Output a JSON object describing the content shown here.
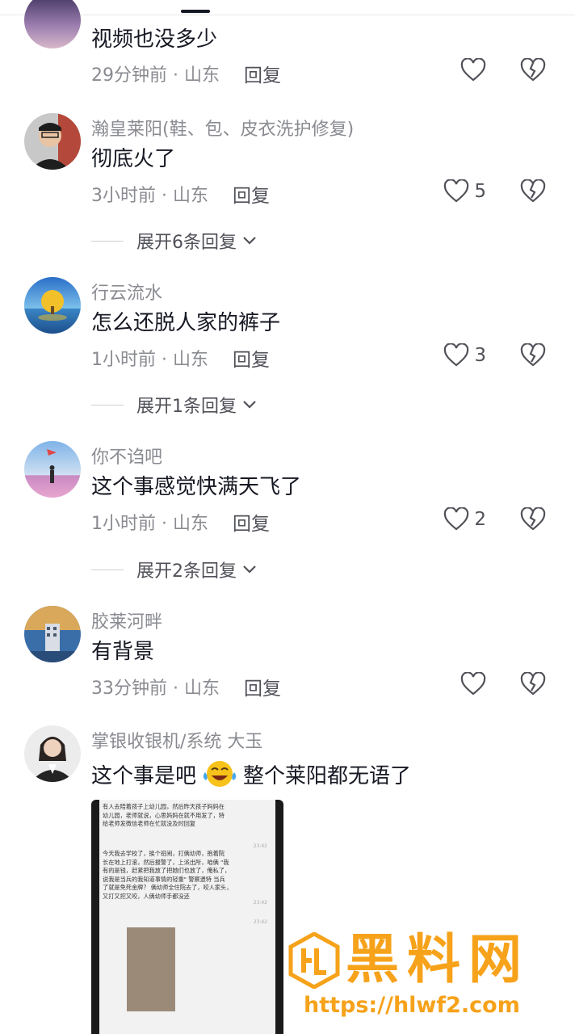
{
  "comments": [
    {
      "username": "",
      "content": "视频也没多少",
      "time_location": "29分钟前 · 山东",
      "reply": "回复",
      "likes": ""
    },
    {
      "username": "瀚皇莱阳(鞋、包、皮衣洗护修复)",
      "content": "彻底火了",
      "time_location": "3小时前 · 山东",
      "reply": "回复",
      "likes": "5",
      "expand": "展开6条回复"
    },
    {
      "username": "行云流水",
      "content": "怎么还脱人家的裤子",
      "time_location": "1小时前 · 山东",
      "reply": "回复",
      "likes": "3",
      "expand": "展开1条回复"
    },
    {
      "username": "你不诌吧",
      "content": "这个事感觉快满天飞了",
      "time_location": "1小时前 · 山东",
      "reply": "回复",
      "likes": "2",
      "expand": "展开2条回复"
    },
    {
      "username": "胶莱河畔",
      "content": "有背景",
      "time_location": "33分钟前 · 山东",
      "reply": "回复",
      "likes": ""
    },
    {
      "username": "掌银收银机/系统 大玉",
      "content_before_emoji": "这个事是吧",
      "content_after_emoji": "整个莱阳都无语了",
      "emoji": "laughing-tears-emoji"
    }
  ],
  "screenshot_image": {
    "text_top": "有人去陪着孩子上幼儿园，然后昨天孩子妈妈在\n幼儿园，老师就说，心思妈妈在就不用发了，特\n给老师发微信老师在忙就没及时回复",
    "time_1": "23:42",
    "text_mid": "今天我去学校了，挨个班闹，打俩幼师，抱着院\n长在地上打滚，然后报警了，上派出所，咱俩 \"我\n有的是钱，赶紧把我放了把她们也放了，俺私了，\n说我是当兵的我知道事情的轻重\" 警察遗特 当兵\n了就是免死金牌？ 俩幼师全住院去了，咬人家头，\n又打又挖又咬，人俩幼师手都没还",
    "time_2": "23:42",
    "time_3": "23:42"
  },
  "watermark": {
    "title": "黑料网",
    "url": "https://hlwf2.com"
  },
  "colors": {
    "text_primary": "#161823",
    "text_secondary": "#8a8b91",
    "watermark": "#f6a21a"
  }
}
